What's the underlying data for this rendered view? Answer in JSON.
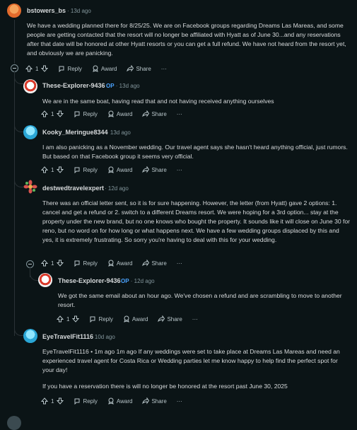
{
  "comments": [
    {
      "user": "bstowers_bs",
      "op": "",
      "time": "13d ago",
      "body": [
        "We have a wedding planned there for 8/25/25. We are on Facebook groups regarding Dreams Las Mareas, and some people are getting contacted that the resort will no longer be affiliated with Hyatt as of June 30...and any reservations after that date will be honored at other Hyatt resorts or you can get a full refund. We have not heard from the resort yet, and obviously we are panicking."
      ],
      "votes": "1",
      "colors": [
        "#f5a35b",
        "#e36b2c"
      ]
    },
    {
      "user": "These-Explorer-9436",
      "op": "OP",
      "time": "13d ago",
      "body": [
        "We are in the same boat, having read that and not having received anything ourselves"
      ],
      "votes": "1"
    },
    {
      "user": "Kooky_Meringue8344",
      "op": "",
      "time": "13d ago",
      "body": [
        "I am also panicking as a November wedding. Our travel agent says she hasn't heard anything official, just rumors. But based on that Facebook group it seems very official."
      ],
      "votes": "1"
    },
    {
      "user": "destwedtravelexpert",
      "op": "",
      "time": "12d ago",
      "body": [
        "There was an official letter sent, so it is for sure happening. However, the letter (from Hyatt) gave 2 options: 1. cancel and get a refund or 2. switch to a different Dreams resort. We were hoping for a 3rd option... stay at the property under the new brand, but no one knows who bought the property. It sounds like it will close on June 30 for reno, but no word on for how long or what happens next. We have a few wedding groups displaced by this and yes, it is extremely frustrating. So sorry you're having to deal with this for your wedding."
      ],
      "votes": "1"
    },
    {
      "user": "These-Explorer-9436",
      "op": "OP",
      "time": "12d ago",
      "body": [
        "We got the same email about an hour ago. We've chosen a refund and are scrambling to move to another resort."
      ],
      "votes": "1"
    },
    {
      "user": "EyeTravelFit1116",
      "op": "",
      "time": "10d ago",
      "body": [
        "EyeTravelFit1116 • 1m ago 1m ago If any weddings were set to take place at Dreams Las Mareas and need an experienced travel agent for Costa Rica or Wedding parties let me know happy to help find the perfect spot for your day!",
        "If you have a reservation there is will no longer be honored at the resort past June 30, 2025"
      ],
      "votes": "1"
    }
  ],
  "actions": {
    "reply": "Reply",
    "award": "Award",
    "share": "Share",
    "more": "···"
  },
  "icons": [
    "upvote-icon",
    "downvote-icon",
    "reply-icon",
    "award-icon",
    "share-icon",
    "collapse-icon"
  ]
}
